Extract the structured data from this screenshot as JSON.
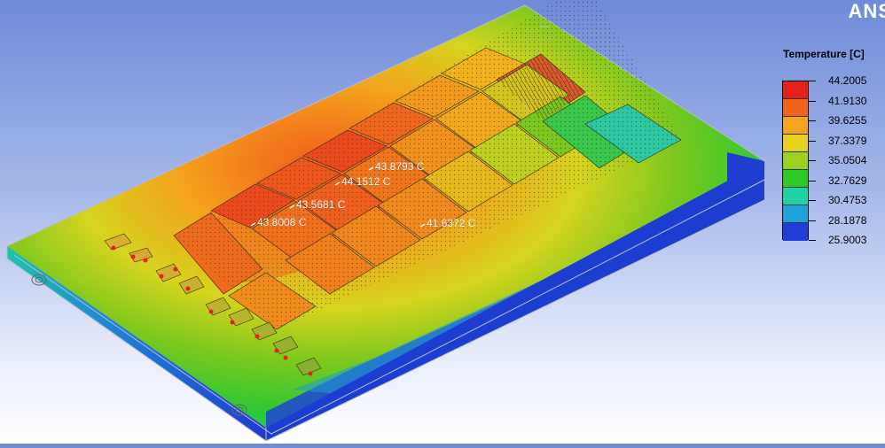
{
  "app": {
    "logo_text": "ANS"
  },
  "legend": {
    "title": "Temperature [C]",
    "ticks": [
      "44.2005",
      "41.9130",
      "39.6255",
      "37.3379",
      "35.0504",
      "32.7629",
      "30.4753",
      "28.1878",
      "25.9003"
    ],
    "colors": [
      "#e8201c",
      "#f0641c",
      "#f4a41c",
      "#e6d21e",
      "#9ad41e",
      "#2ec828",
      "#1ed2a6",
      "#1ea4d8",
      "#1e3ed8"
    ]
  },
  "probes": [
    {
      "label": "43.8793 C"
    },
    {
      "label": "44.1512 C"
    },
    {
      "label": "43.5681 C"
    },
    {
      "label": "43.8008 C"
    },
    {
      "label": "41.6372 C"
    }
  ]
}
